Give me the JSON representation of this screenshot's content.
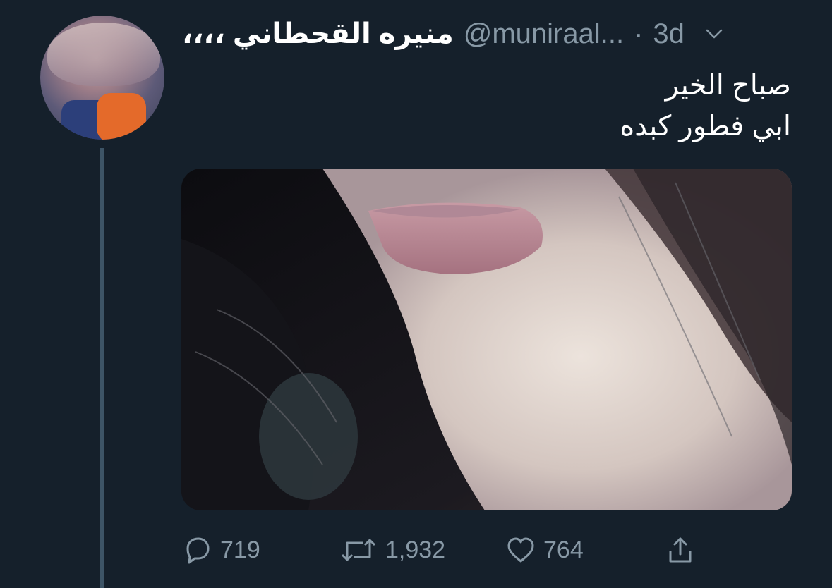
{
  "tweet": {
    "display_name": "منيره القحطاني ،،،،",
    "handle": "@muniraal...",
    "separator": "·",
    "time": "3d",
    "text_lines": [
      "صباح الخير",
      "ابي فطور كبده"
    ]
  },
  "actions": {
    "replies": "719",
    "retweets": "1,932",
    "likes": "764"
  },
  "icons": {
    "reply": "reply-icon",
    "retweet": "retweet-icon",
    "like": "heart-icon",
    "share": "share-icon",
    "menu": "chevron-down-icon"
  },
  "colors": {
    "background": "#15202b",
    "secondary_text": "#8899a6",
    "thread_line": "#3d5466"
  }
}
